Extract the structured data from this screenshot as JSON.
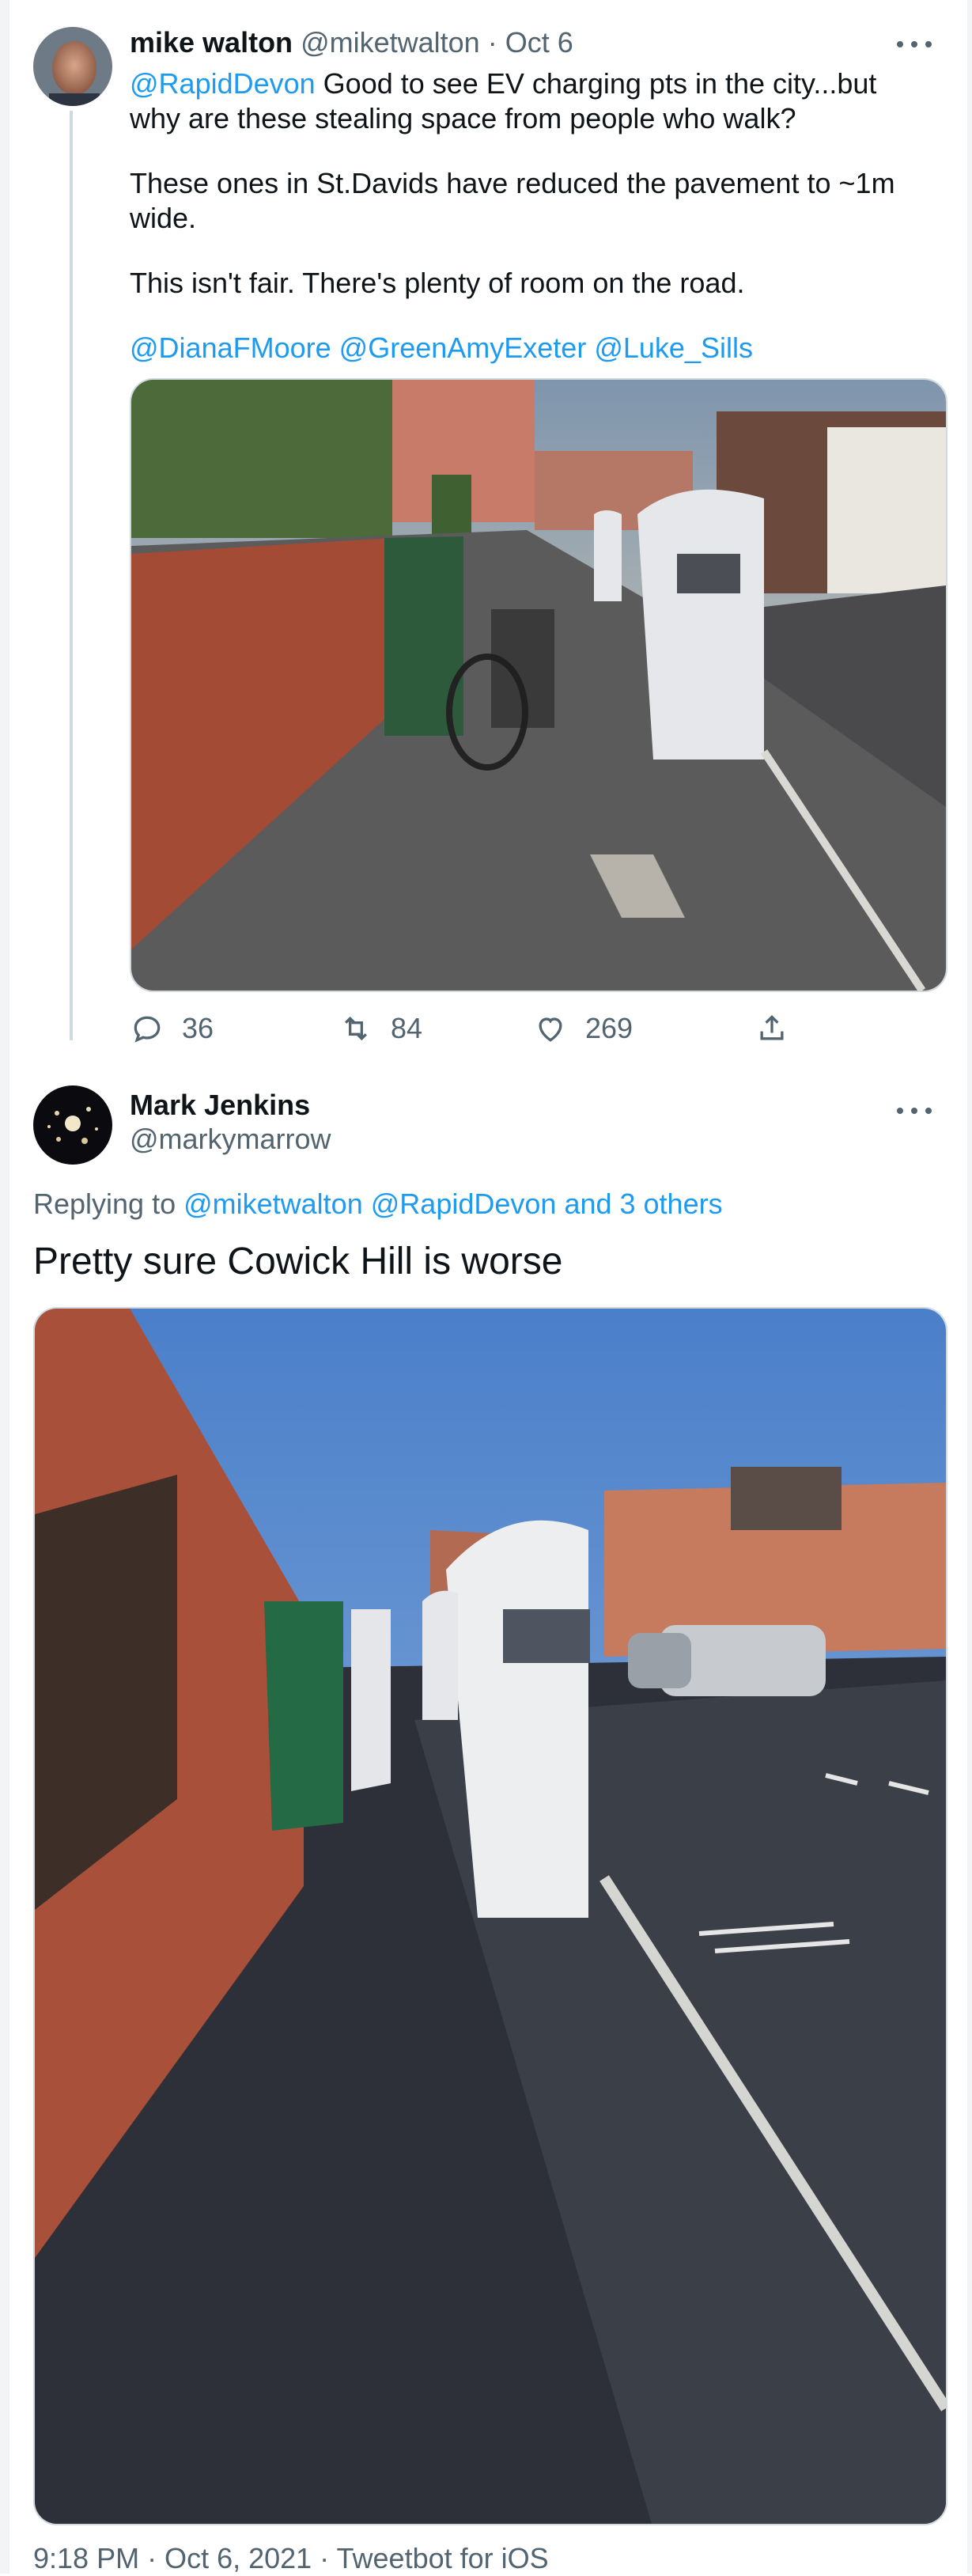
{
  "tweet1": {
    "author_name": "mike walton",
    "author_handle": "@miketwalton",
    "separator": " · ",
    "date": "Oct 6",
    "mention_lead": "@RapidDevon",
    "line1_rest": " Good to see EV charging pts in the city...but why are these stealing space from people who walk?",
    "line2": "These ones in St.Davids have reduced the pavement to ~1m wide.",
    "line3": "This isn't fair.  There's plenty of room on the road.",
    "mentions": [
      "@DianaFMoore",
      "@GreenAmyExeter",
      "@Luke_Sills"
    ],
    "actions": {
      "replies": "36",
      "retweets": "84",
      "likes": "269"
    }
  },
  "tweet2": {
    "author_name": "Mark Jenkins",
    "author_handle": "@markymarrow",
    "replying_prefix": "Replying to ",
    "replying_to": [
      "@miketwalton",
      "@RapidDevon"
    ],
    "replying_others": "and 3 others",
    "text": "Pretty sure Cowick Hill is worse",
    "footer": "9:18 PM · Oct 6, 2021 · Tweetbot for iOS"
  },
  "icons": {
    "more": "more-horizontal-icon",
    "reply": "reply-icon",
    "retweet": "retweet-icon",
    "like": "heart-icon",
    "share": "share-icon"
  },
  "colors": {
    "link": "#1d9bf0",
    "muted": "#536471",
    "text": "#0f1419",
    "border": "#cfd9de"
  }
}
